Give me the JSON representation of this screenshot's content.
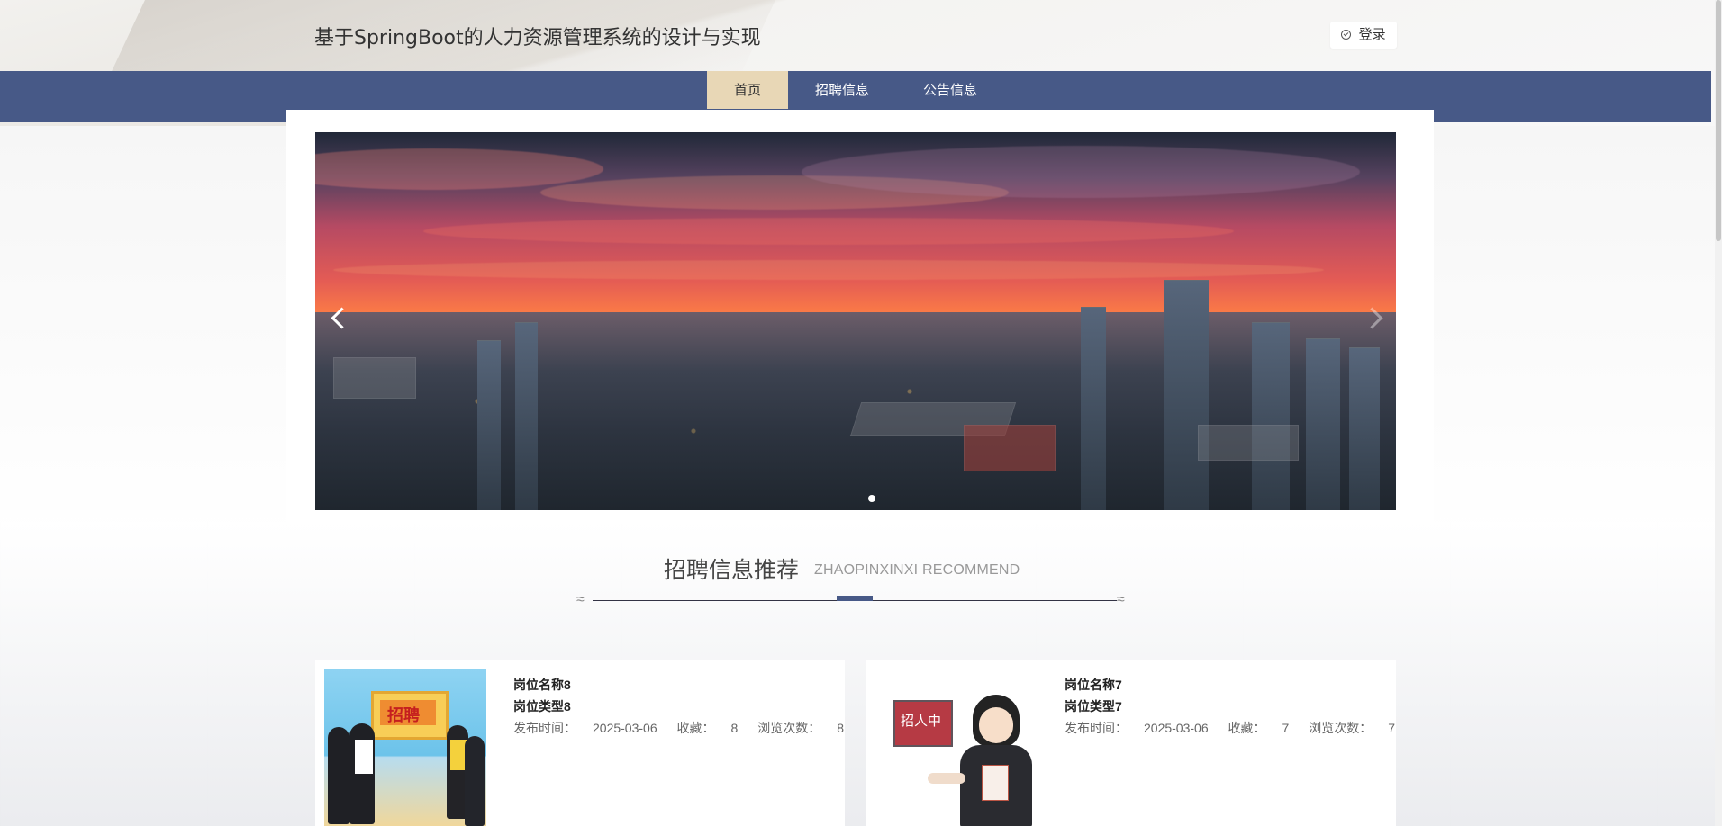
{
  "header": {
    "title": "基于SpringBoot的人力资源管理系统的设计与实现",
    "login_label": "登录",
    "login_icon": "check-circle-icon"
  },
  "nav": {
    "items": [
      {
        "label": "首页",
        "active": true
      },
      {
        "label": "招聘信息",
        "active": false
      },
      {
        "label": "公告信息",
        "active": false
      }
    ]
  },
  "banner": {
    "left_icon": "chevron-left-icon",
    "right_icon": "chevron-right-icon",
    "active_dot": 1
  },
  "section": {
    "title": "招聘信息推荐",
    "subtitle": "ZHAOPINXINXI RECOMMEND"
  },
  "cards": [
    {
      "position_name": "岗位名称8",
      "position_type": "岗位类型8",
      "publish_label": "发布时间：",
      "publish_time": "2025-03-06",
      "favorites_label": "收藏：",
      "favorites": "8",
      "views_label": "浏览次数：",
      "views": "8",
      "image_text": "招聘"
    },
    {
      "position_name": "岗位名称7",
      "position_type": "岗位类型7",
      "publish_label": "发布时间：",
      "publish_time": "2025-03-06",
      "favorites_label": "收藏：",
      "favorites": "7",
      "views_label": "浏览次数：",
      "views": "7",
      "image_text": "招人中"
    }
  ],
  "colors": {
    "nav": "#475987",
    "nav_active": "#e8d7b6",
    "text_dark": "#333333",
    "subtitle": "#999999"
  }
}
